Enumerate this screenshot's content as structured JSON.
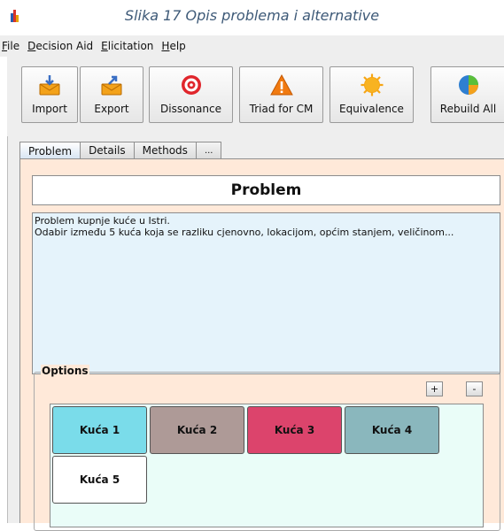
{
  "caption": "Slika 17 Opis problema i alternative",
  "menubar": {
    "items": [
      {
        "pre": "",
        "u": "F",
        "post": "ile"
      },
      {
        "pre": "",
        "u": "D",
        "post": "ecision Aid"
      },
      {
        "pre": "",
        "u": "E",
        "post": "licitation"
      },
      {
        "pre": "",
        "u": "H",
        "post": "elp"
      }
    ]
  },
  "toolbar": {
    "import": "Import",
    "export": "Export",
    "dissonance": "Dissonance",
    "triad": "Triad for CM",
    "equivalence": "Equivalence",
    "rebuild": "Rebuild All"
  },
  "tabs": {
    "problem": "Problem",
    "details": "Details",
    "methods": "Methods",
    "more": "..."
  },
  "problem": {
    "title": "Problem",
    "description_lines": [
      "Problem kupnje kuće u Istri.",
      "Odabir između 5 kuća koja se razliku cjenovno, lokacijom, općim stanjem, veličinom..."
    ]
  },
  "options": {
    "label": "Options",
    "add": "+",
    "remove": "-",
    "items": [
      {
        "name": "Kuća 1",
        "color": "#7adcea"
      },
      {
        "name": "Kuća 2",
        "color": "#ae9a97"
      },
      {
        "name": "Kuća 3",
        "color": "#dc446c"
      },
      {
        "name": "Kuća 4",
        "color": "#8ab7bd"
      },
      {
        "name": "Kuća 5",
        "color": "#ffffff"
      }
    ]
  },
  "colors": {
    "panel_bg": "#ffe9d9",
    "description_bg": "#e5f3fb",
    "options_bg": "#eafdf8"
  }
}
